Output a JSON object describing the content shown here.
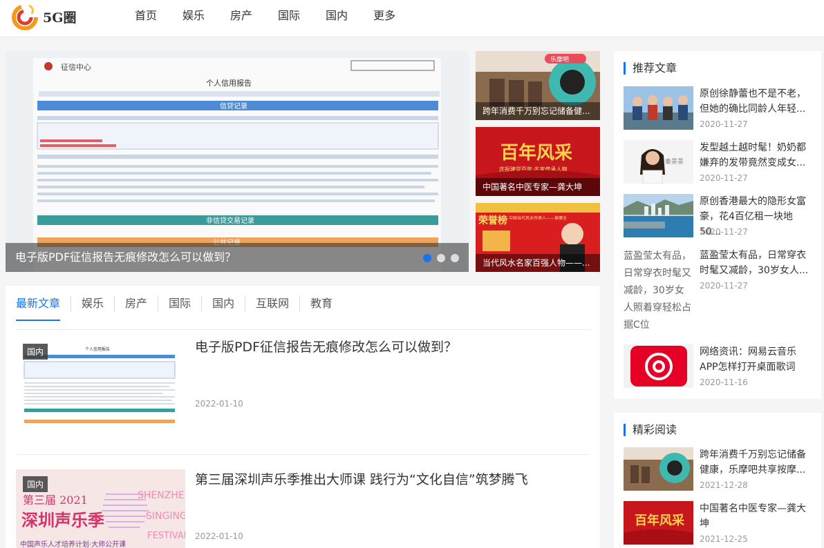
{
  "brand": {
    "name": "5G圈",
    "colors": {
      "accent": "#1a73e8",
      "logo_orange": "#f39a1d",
      "logo_red": "#e23b2b"
    }
  },
  "nav": [
    "首页",
    "娱乐",
    "房产",
    "国际",
    "国内",
    "更多"
  ],
  "slider": {
    "caption": "电子版PDF征信报告无痕修改怎么可以做到？",
    "image_text": {
      "org": "征信中心",
      "title": "个人信用报告",
      "section1": "信贷记录",
      "section2": "非信贷交易记录",
      "section3": "公共记录"
    },
    "dots": 3
  },
  "side_thumbs": [
    {
      "caption": "跨年消费千万别忘记储备健...",
      "image_text": "乐摩吧"
    },
    {
      "caption": "中国著名中医专家—龚大坤",
      "image_text": "百年风采",
      "image_subtext": "庆祝建党百年·名家传承人物"
    },
    {
      "caption": "当代风水名家百强人物——...",
      "image_text": "荣誉榜",
      "image_subtext": "中国当代风水传承人——章赓全"
    }
  ],
  "tabs": [
    "最新文章",
    "娱乐",
    "房产",
    "国际",
    "国内",
    "互联网",
    "教育"
  ],
  "posts": [
    {
      "tag": "国内",
      "title": "电子版PDF征信报告无痕修改怎么可以做到？",
      "date": "2022-01-10",
      "image_text": "个人信用报告"
    },
    {
      "tag": "国内",
      "title": "第三届深圳声乐季推出大师课 践行为“文化自信”筑梦腾飞",
      "date": "2022-01-10",
      "image_text": {
        "line1": "第三届 2021",
        "line2": "深圳声乐季",
        "line3": "中国声乐人才培养计划·大师公开课",
        "en1": "SHENZHEN",
        "en2": "SINGING",
        "en3": "FESTIVAL"
      }
    }
  ],
  "recommended": {
    "title": "推荐文章",
    "items": [
      {
        "title": "原创徐静蕾也不是不老，但她的确比同龄人年轻...",
        "date": "2020-11-27"
      },
      {
        "title": "发型越土越时髦！奶奶都嫌弃的发带竟然变成女...",
        "date": "2020-11-27",
        "image_text": "秦景景"
      },
      {
        "title": "原创香港最大的隐形女富豪，花4百亿租一块地50...",
        "date": "2020-11-27"
      },
      {
        "title": "蓝盈莹太有品，日常穿衣时髦又减龄，30岁女人...",
        "date": "2020-11-27",
        "alt": "蓝盈莹太有品，日常穿衣时髦又减龄，30岁女人照着穿轻松占据C位"
      },
      {
        "title": "网络资讯：网易云音乐APP怎样打开桌面歌词",
        "date": "2020-11-16"
      }
    ]
  },
  "featured": {
    "title": "精彩阅读",
    "items": [
      {
        "title": "跨年消费千万别忘记储备健康，乐摩吧共享按摩...",
        "date": "2021-12-28"
      },
      {
        "title": "中国著名中医专家—龚大坤",
        "date": "2021-12-25",
        "image_text": "百年风采"
      }
    ]
  }
}
